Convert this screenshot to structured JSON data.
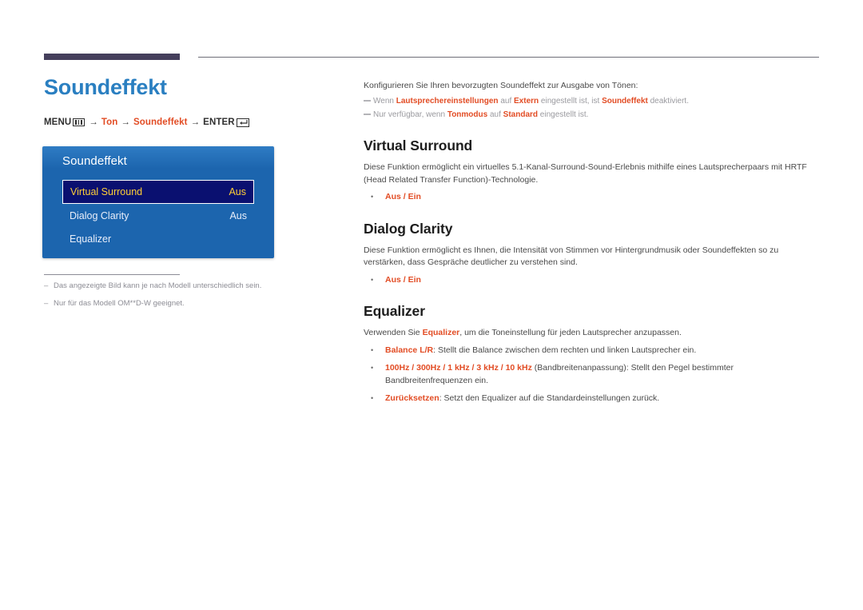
{
  "page": {
    "title": "Soundeffekt",
    "accent_blue": "#2a7fc1",
    "accent_red": "#e24c24",
    "rule_block_color": "#453f5c"
  },
  "breadcrumb": {
    "menu_label": "MENU",
    "menu_icon": "menu-bars-icon",
    "arrow": "→",
    "step1": "Ton",
    "step2": "Soundeffekt",
    "enter_label": "ENTER",
    "enter_icon": "enter-return-icon"
  },
  "osd": {
    "title": "Soundeffekt",
    "rows": [
      {
        "label": "Virtual Surround",
        "value": "Aus",
        "selected": true
      },
      {
        "label": "Dialog Clarity",
        "value": "Aus",
        "selected": false
      },
      {
        "label": "Equalizer",
        "value": "",
        "selected": false
      }
    ]
  },
  "left_notes": [
    {
      "dash": "–",
      "text": "Das angezeigte Bild kann je nach Modell unterschiedlich sein."
    },
    {
      "dash": "–",
      "text": "Nur für das Modell OM**D-W geeignet."
    }
  ],
  "right": {
    "intro": "Konfigurieren Sie Ihren bevorzugten Soundeffekt zur Ausgabe von Tönen:",
    "notes": [
      {
        "p1": "Wenn ",
        "b1": "Lautsprechereinstellungen",
        "p2": " auf ",
        "b2": "Extern",
        "p3": " eingestellt ist, ist ",
        "b3": "Soundeffekt",
        "p4": " deaktiviert."
      },
      {
        "p1": "Nur verfügbar, wenn ",
        "b1": "Tonmodus",
        "p2": " auf ",
        "b2": "Standard",
        "p3": " eingestellt ist.",
        "b3": "",
        "p4": ""
      }
    ],
    "sections": [
      {
        "heading": "Virtual Surround",
        "body": "Diese Funktion ermöglicht ein virtuelles 5.1-Kanal-Surround-Sound-Erlebnis mithilfe eines Lautsprecherpaars mit HRTF (Head Related Transfer Function)-Technologie.",
        "bullets": [
          {
            "bold": "Aus / Ein",
            "rest": ""
          }
        ]
      },
      {
        "heading": "Dialog Clarity",
        "body": "Diese Funktion ermöglicht es Ihnen, die Intensität von Stimmen vor Hintergrundmusik oder Soundeffekten so zu verstärken, dass Gespräche deutlicher zu verstehen sind.",
        "bullets": [
          {
            "bold": "Aus / Ein",
            "rest": ""
          }
        ]
      },
      {
        "heading": "Equalizer",
        "body_pre": "Verwenden Sie ",
        "body_bold": "Equalizer",
        "body_post": ", um die Toneinstellung für jeden Lautsprecher anzupassen.",
        "bullets": [
          {
            "bold": "Balance L/R",
            "rest": ": Stellt die Balance zwischen dem rechten und linken Lautsprecher ein."
          },
          {
            "bold": "100Hz / 300Hz / 1 kHz / 3 kHz / 10 kHz",
            "rest": " (Bandbreitenanpassung): Stellt den Pegel bestimmter Bandbreitenfrequenzen ein."
          },
          {
            "bold": "Zurücksetzen",
            "rest": ": Setzt den Equalizer auf die Standardeinstellungen zurück."
          }
        ]
      }
    ]
  }
}
